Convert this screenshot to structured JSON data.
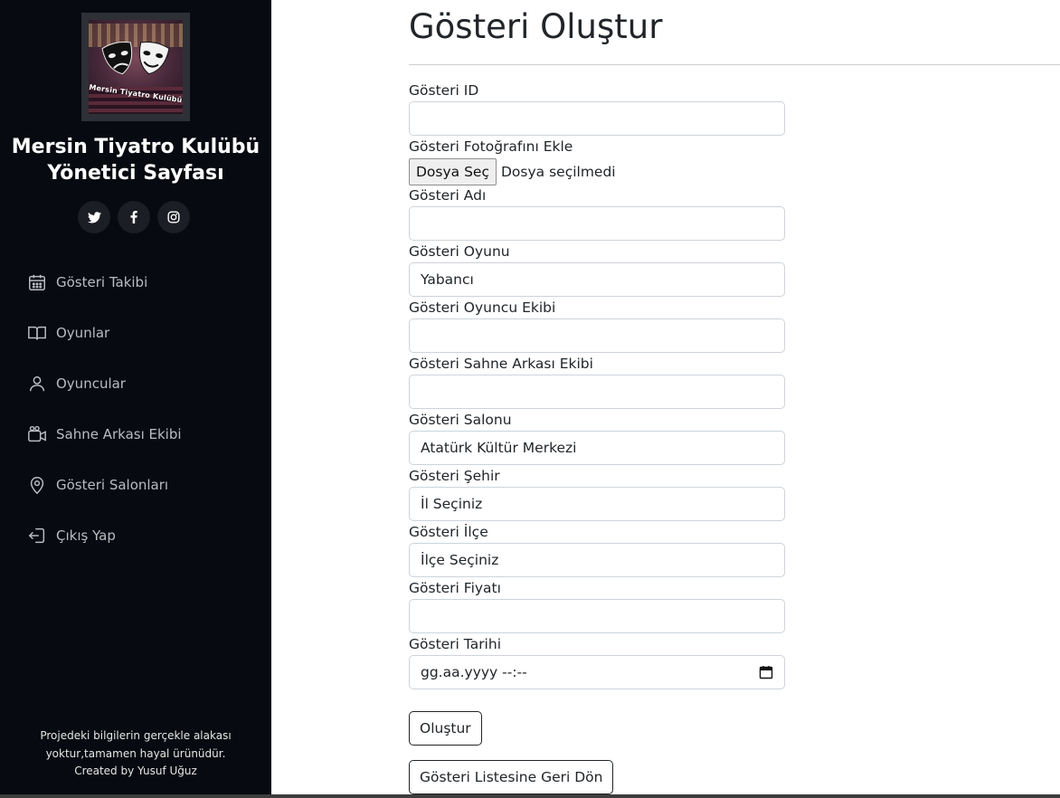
{
  "sidebar": {
    "logo_text": "Mersin Tiyatro Kulübü",
    "title_line1": "Mersin Tiyatro Kulübü",
    "title_line2": "Yönetici Sayfası",
    "socials": [
      "twitter-icon",
      "facebook-icon",
      "instagram-icon"
    ],
    "nav": [
      {
        "label": "Gösteri Takibi",
        "icon": "calendar-icon"
      },
      {
        "label": "Oyunlar",
        "icon": "book-icon"
      },
      {
        "label": "Oyuncular",
        "icon": "user-icon"
      },
      {
        "label": "Sahne Arkası Ekibi",
        "icon": "video-camera-icon"
      },
      {
        "label": "Gösteri Salonları",
        "icon": "map-pin-icon"
      },
      {
        "label": "Çıkış Yap",
        "icon": "logout-icon"
      }
    ],
    "footer_line1": "Projedeki bilgilerin gerçekle alakası",
    "footer_line2": "yoktur,tamamen hayal ürünüdür.",
    "footer_line3": "Created by Yusuf Uğuz"
  },
  "main": {
    "title": "Gösteri Oluştur",
    "fields": {
      "id_label": "Gösteri ID",
      "id_value": "",
      "photo_label": "Gösteri Fotoğrafını Ekle",
      "photo_button": "Dosya Seç",
      "photo_status": "Dosya seçilmedi",
      "name_label": "Gösteri Adı",
      "name_value": "",
      "play_label": "Gösteri Oyunu",
      "play_value": "Yabancı",
      "cast_label": "Gösteri Oyuncu Ekibi",
      "cast_value": "",
      "crew_label": "Gösteri Sahne Arkası Ekibi",
      "crew_value": "",
      "hall_label": "Gösteri Salonu",
      "hall_value": "Atatürk Kültür Merkezi",
      "city_label": "Gösteri Şehir",
      "city_value": "İl Seçiniz",
      "district_label": "Gösteri İlçe",
      "district_value": "İlçe Seçiniz",
      "price_label": "Gösteri Fiyatı",
      "price_value": "",
      "date_label": "Gösteri Tarihi",
      "date_value": "gg.aa.yyyy --:--"
    },
    "create_button": "Oluştur",
    "back_button": "Gösteri Listesine Geri Dön"
  },
  "colors": {
    "sidebar_bg": "#070a10",
    "sidebar_text": "#b9bcc2",
    "border": "#ced4da"
  }
}
